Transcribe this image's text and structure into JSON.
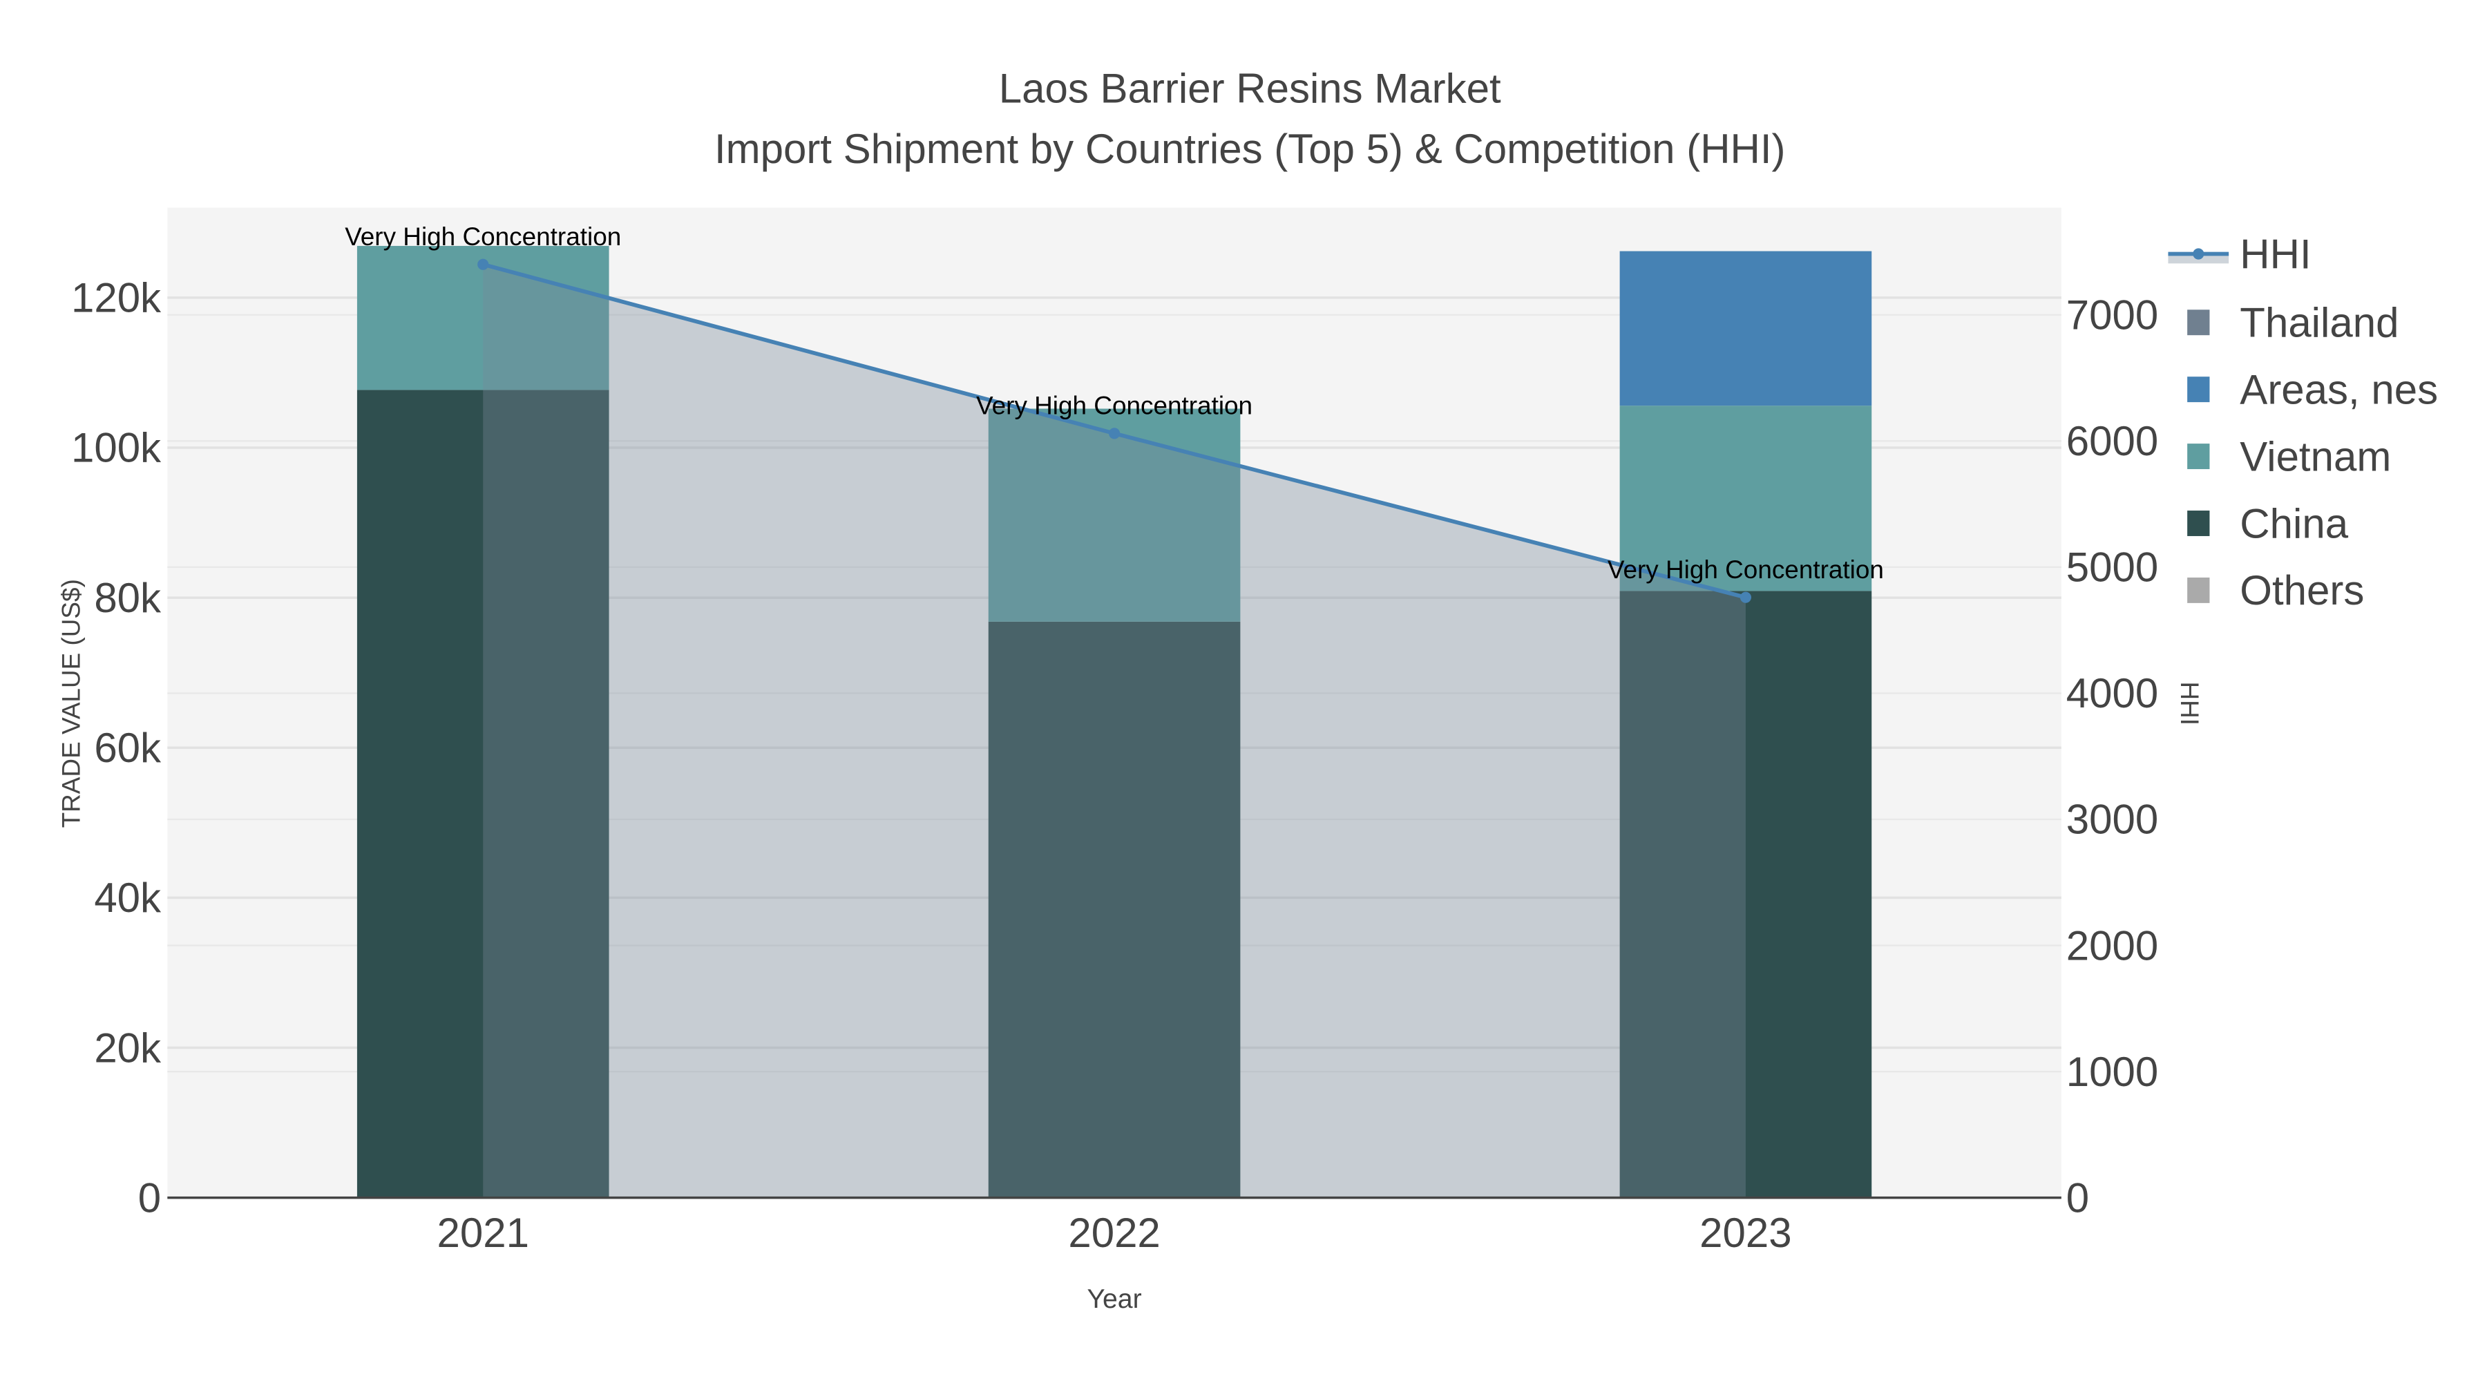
{
  "chart_data": {
    "type": "bar",
    "stacked": true,
    "title": "Laos Barrier Resins Market",
    "subtitle": "Import Shipment by Countries (Top 5) & Competition (HHI)",
    "xlabel": "Year",
    "ylabel": "TRADE VALUE (US$)",
    "y2label": "HHI",
    "categories": [
      "2021",
      "2022",
      "2023"
    ],
    "ylim": [
      0,
      132000
    ],
    "y2lim": [
      0,
      7850
    ],
    "yticks": [
      0,
      20000,
      40000,
      60000,
      80000,
      100000,
      120000
    ],
    "ytick_labels": [
      "0",
      "20k",
      "40k",
      "60k",
      "80k",
      "100k",
      "120k"
    ],
    "y2ticks": [
      0,
      1000,
      2000,
      3000,
      4000,
      5000,
      6000,
      7000
    ],
    "y2tick_labels": [
      "0",
      "1000",
      "2000",
      "3000",
      "4000",
      "5000",
      "6000",
      "7000"
    ],
    "grid": true,
    "legend_position": "right",
    "series": [
      {
        "name": "China",
        "color": "#2f4f4f",
        "values": [
          107700,
          76800,
          80900
        ]
      },
      {
        "name": "Vietnam",
        "color": "#5f9ea0",
        "values": [
          19200,
          28400,
          24700
        ]
      },
      {
        "name": "Areas, nes",
        "color": "#4682b4",
        "values": [
          0,
          0,
          20600
        ]
      },
      {
        "name": "Thailand",
        "color": "#708090",
        "values": [
          0,
          0,
          0
        ]
      },
      {
        "name": "Others",
        "color": "#aaaaaa",
        "values": [
          0,
          0,
          0
        ]
      }
    ],
    "hhi": {
      "name": "HHI",
      "color": "#4682b4",
      "fill": "rgba(119,136,153,0.36)",
      "values": [
        7400,
        6060,
        4760
      ],
      "annotations": [
        "Very High Concentration",
        "Very High Concentration",
        "Very High Concentration"
      ]
    },
    "legend_order": [
      "HHI",
      "Thailand",
      "Areas, nes",
      "Vietnam",
      "China",
      "Others"
    ]
  }
}
